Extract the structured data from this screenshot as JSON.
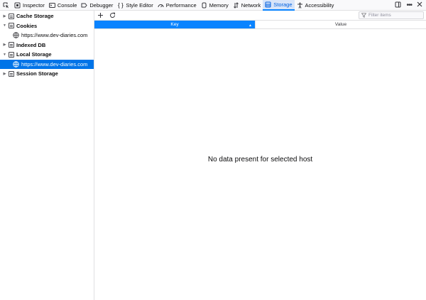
{
  "toolbar": {
    "tabs": [
      {
        "label": "Inspector",
        "icon": "inspector-icon"
      },
      {
        "label": "Console",
        "icon": "console-icon"
      },
      {
        "label": "Debugger",
        "icon": "debugger-icon"
      },
      {
        "label": "Style Editor",
        "icon": "style-editor-icon"
      },
      {
        "label": "Performance",
        "icon": "performance-icon"
      },
      {
        "label": "Memory",
        "icon": "memory-icon"
      },
      {
        "label": "Network",
        "icon": "network-icon"
      },
      {
        "label": "Storage",
        "icon": "storage-icon",
        "selected": true
      },
      {
        "label": "Accessibility",
        "icon": "accessibility-icon"
      }
    ]
  },
  "sidebar": {
    "items": [
      {
        "label": "Cache Storage",
        "level": 0,
        "expanded": false
      },
      {
        "label": "Cookies",
        "level": 0,
        "expanded": true
      },
      {
        "label": "https://www.dev-diaries.com",
        "level": 1
      },
      {
        "label": "Indexed DB",
        "level": 0,
        "expanded": false
      },
      {
        "label": "Local Storage",
        "level": 0,
        "expanded": true
      },
      {
        "label": "https://www.dev-diaries.com",
        "level": 1,
        "selected": true
      },
      {
        "label": "Session Storage",
        "level": 0,
        "expanded": false
      }
    ]
  },
  "main": {
    "filter_placeholder": "Filter items",
    "columns": {
      "key": "Key",
      "value": "Value"
    },
    "empty_message": "No data present for selected host"
  },
  "colors": {
    "accent": "#0a84ff",
    "selected_row": "#0074e8"
  }
}
